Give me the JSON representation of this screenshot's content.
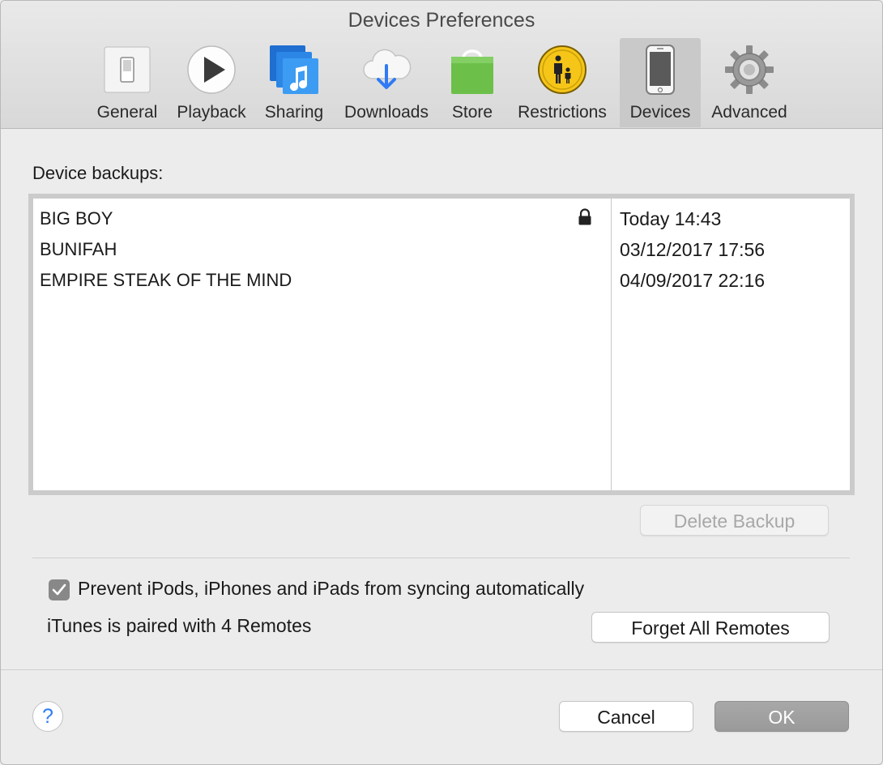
{
  "window": {
    "title": "Devices Preferences"
  },
  "toolbar": {
    "tabs": [
      {
        "label": "General",
        "icon": "general-switch-icon"
      },
      {
        "label": "Playback",
        "icon": "play-icon"
      },
      {
        "label": "Sharing",
        "icon": "music-note-icon"
      },
      {
        "label": "Downloads",
        "icon": "cloud-download-icon"
      },
      {
        "label": "Store",
        "icon": "shopping-bag-icon"
      },
      {
        "label": "Restrictions",
        "icon": "parental-control-icon"
      },
      {
        "label": "Devices",
        "icon": "iphone-icon",
        "selected": true
      },
      {
        "label": "Advanced",
        "icon": "gear-icon"
      }
    ]
  },
  "backups": {
    "label": "Device backups:",
    "rows": [
      {
        "name": "BIG BOY",
        "date": "Today 14:43",
        "locked": true
      },
      {
        "name": "BUNIFAH",
        "date": "03/12/2017 17:56",
        "locked": false
      },
      {
        "name": "EMPIRE STEAK OF THE MIND",
        "date": "04/09/2017 22:16",
        "locked": false
      }
    ],
    "delete_label": "Delete Backup"
  },
  "sync": {
    "prevent_label": "Prevent iPods, iPhones and iPads from syncing automatically",
    "prevent_checked": true,
    "paired_label": "iTunes is paired with 4 Remotes",
    "forget_label": "Forget All Remotes"
  },
  "footer": {
    "help_label": "?",
    "cancel_label": "Cancel",
    "ok_label": "OK"
  },
  "colors": {
    "accent_blue": "#2f7bf5",
    "store_green": "#6cc04a",
    "restrictions_yellow": "#f5c518"
  }
}
